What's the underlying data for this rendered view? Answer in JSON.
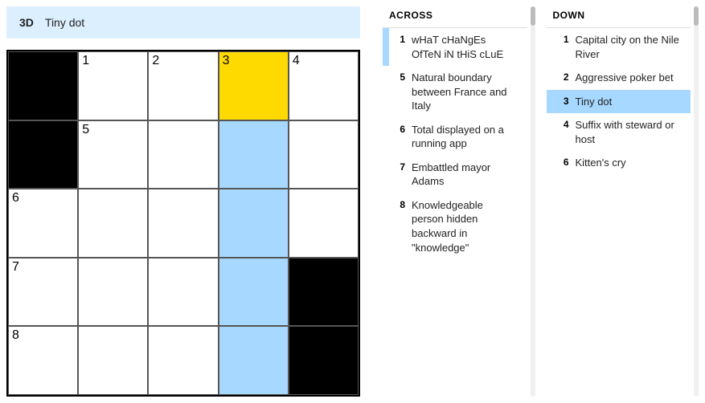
{
  "clueBar": {
    "number": "3D",
    "text": "Tiny dot"
  },
  "grid": {
    "size": 5,
    "cells": [
      {
        "r": 0,
        "c": 0,
        "black": true
      },
      {
        "r": 0,
        "c": 1,
        "num": "1"
      },
      {
        "r": 0,
        "c": 2,
        "num": "2"
      },
      {
        "r": 0,
        "c": 3,
        "num": "3",
        "state": "focus"
      },
      {
        "r": 0,
        "c": 4,
        "num": "4"
      },
      {
        "r": 1,
        "c": 0,
        "black": true
      },
      {
        "r": 1,
        "c": 1,
        "num": "5"
      },
      {
        "r": 1,
        "c": 2
      },
      {
        "r": 1,
        "c": 3,
        "state": "highlight"
      },
      {
        "r": 1,
        "c": 4
      },
      {
        "r": 2,
        "c": 0,
        "num": "6"
      },
      {
        "r": 2,
        "c": 1
      },
      {
        "r": 2,
        "c": 2
      },
      {
        "r": 2,
        "c": 3,
        "state": "highlight"
      },
      {
        "r": 2,
        "c": 4
      },
      {
        "r": 3,
        "c": 0,
        "num": "7"
      },
      {
        "r": 3,
        "c": 1
      },
      {
        "r": 3,
        "c": 2
      },
      {
        "r": 3,
        "c": 3,
        "state": "highlight"
      },
      {
        "r": 3,
        "c": 4,
        "black": true
      },
      {
        "r": 4,
        "c": 0,
        "num": "8"
      },
      {
        "r": 4,
        "c": 1
      },
      {
        "r": 4,
        "c": 2
      },
      {
        "r": 4,
        "c": 3,
        "state": "highlight"
      },
      {
        "r": 4,
        "c": 4,
        "black": true
      }
    ]
  },
  "across": {
    "header": "ACROSS",
    "clues": [
      {
        "num": "1",
        "text": "wHaT cHaNgEs OfTeN iN tHiS cLuE",
        "related": true
      },
      {
        "num": "5",
        "text": "Natural boundary between France and Italy"
      },
      {
        "num": "6",
        "text": "Total displayed on a running app"
      },
      {
        "num": "7",
        "text": "Embattled mayor Adams"
      },
      {
        "num": "8",
        "text": "Knowledgeable person hidden backward in \"knowledge\""
      }
    ]
  },
  "down": {
    "header": "DOWN",
    "clues": [
      {
        "num": "1",
        "text": "Capital city on the Nile River"
      },
      {
        "num": "2",
        "text": "Aggressive poker bet"
      },
      {
        "num": "3",
        "text": "Tiny dot",
        "selected": true
      },
      {
        "num": "4",
        "text": "Suffix with steward or host"
      },
      {
        "num": "6",
        "text": "Kitten's cry"
      }
    ]
  }
}
